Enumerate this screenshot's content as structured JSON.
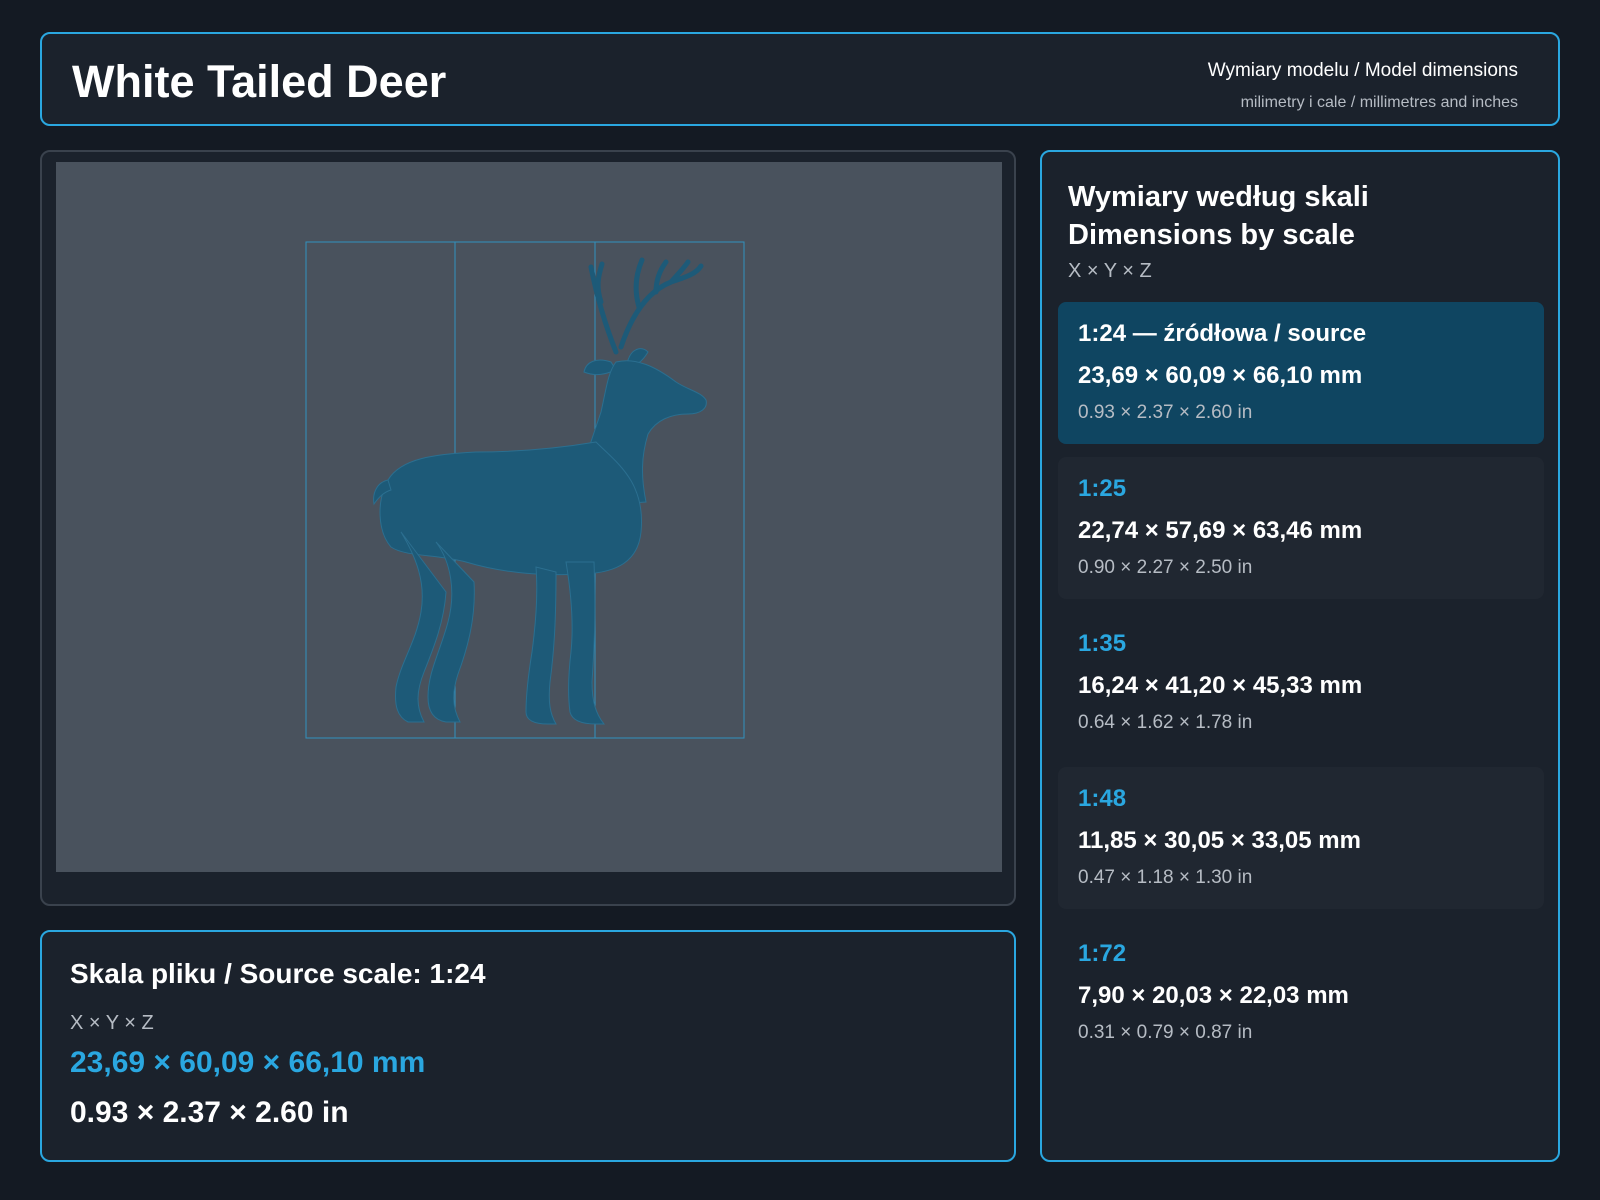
{
  "header": {
    "title": "White Tailed Deer",
    "subtitle": "Wymiary modelu / Model dimensions",
    "units_note": "milimetry i cale / millimetres and inches"
  },
  "colors": {
    "accent": "#2aa7e0",
    "background": "#141a23",
    "panel": "#1b222c",
    "active_card": "#0f4561",
    "model": "#1d5a78"
  },
  "viewer": {
    "model_icon": "deer-model-icon"
  },
  "source": {
    "title": "Skala pliku / Source scale: 1:24",
    "axes": "X × Y × Z",
    "mm": "23,69 × 60,09 × 66,10 mm",
    "in": "0.93 × 2.37 × 2.60 in"
  },
  "scales": {
    "title_pl": "Wymiary według skali",
    "title_en": "Dimensions by scale",
    "axes": "X × Y × Z",
    "items": [
      {
        "label": "1:24  —  źródłowa / source",
        "mm": "23,69 × 60,09 × 66,10 mm",
        "in": "0.93 × 2.37 × 2.60 in"
      },
      {
        "label": "1:25",
        "mm": "22,74 × 57,69 × 63,46 mm",
        "in": "0.90 × 2.27 × 2.50 in"
      },
      {
        "label": "1:35",
        "mm": "16,24 × 41,20 × 45,33 mm",
        "in": "0.64 × 1.62 × 1.78 in"
      },
      {
        "label": "1:48",
        "mm": "11,85 × 30,05 × 33,05 mm",
        "in": "0.47 × 1.18 × 1.30 in"
      },
      {
        "label": "1:72",
        "mm": "7,90 × 20,03 × 22,03 mm",
        "in": "0.31 × 0.79 × 0.87 in"
      }
    ]
  }
}
